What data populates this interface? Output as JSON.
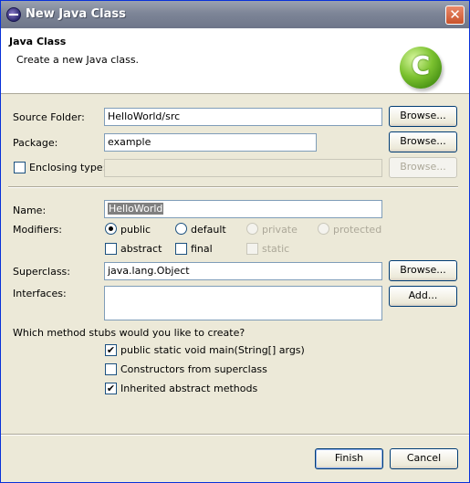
{
  "window": {
    "title": "New Java Class",
    "close_glyph": "✕"
  },
  "header": {
    "title": "Java Class",
    "description": "Create a new Java class.",
    "icon_letter": "C",
    "icon": "java-class-icon"
  },
  "source_folder": {
    "label": "Source Folder:",
    "value": "HelloWorld/src",
    "browse": "Browse..."
  },
  "package": {
    "label": "Package:",
    "value": "example",
    "browse": "Browse..."
  },
  "enclosing": {
    "label": "Enclosing type:",
    "value": "",
    "checked": false,
    "browse": "Browse..."
  },
  "name": {
    "label": "Name:",
    "value": "HelloWorld"
  },
  "modifiers": {
    "label": "Modifiers:",
    "public": "public",
    "default": "default",
    "private": "private",
    "protected": "protected",
    "abstract": "abstract",
    "final": "final",
    "static": "static",
    "selected": "public"
  },
  "superclass": {
    "label": "Superclass:",
    "value": "java.lang.Object",
    "browse": "Browse..."
  },
  "interfaces": {
    "label": "Interfaces:",
    "add": "Add..."
  },
  "stubs": {
    "question": "Which method stubs would you like to create?",
    "main": {
      "label": "public static void main(String[] args)",
      "checked": true
    },
    "constructors": {
      "label": "Constructors from superclass",
      "checked": false
    },
    "inherited": {
      "label": "Inherited abstract methods",
      "checked": true
    },
    "check_glyph": "✔"
  },
  "footer": {
    "finish": "Finish",
    "cancel": "Cancel"
  }
}
